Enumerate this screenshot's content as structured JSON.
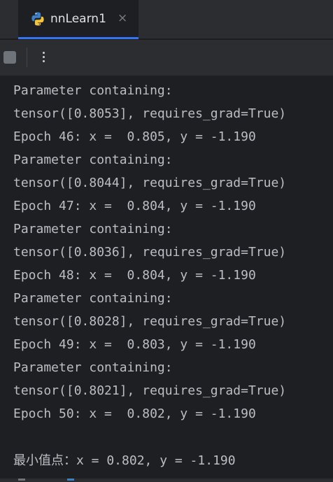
{
  "tab": {
    "label": "nnLearn1",
    "close_glyph": "×",
    "icon": "python-icon",
    "accent": "#3574f0"
  },
  "toolbar": {
    "stop_icon": "stop-icon",
    "more_glyph": "⋮"
  },
  "console": {
    "lines": [
      "Parameter containing:",
      "tensor([0.8053], requires_grad=True)",
      "Epoch 46: x =  0.805, y = -1.190",
      "Parameter containing:",
      "tensor([0.8044], requires_grad=True)",
      "Epoch 47: x =  0.804, y = -1.190",
      "Parameter containing:",
      "tensor([0.8036], requires_grad=True)",
      "Epoch 48: x =  0.804, y = -1.190",
      "Parameter containing:",
      "tensor([0.8028], requires_grad=True)",
      "Epoch 49: x =  0.803, y = -1.190",
      "Parameter containing:",
      "tensor([0.8021], requires_grad=True)",
      "Epoch 50: x =  0.802, y = -1.190",
      "",
      "最小值点：x = 0.802, y = -1.190"
    ]
  }
}
